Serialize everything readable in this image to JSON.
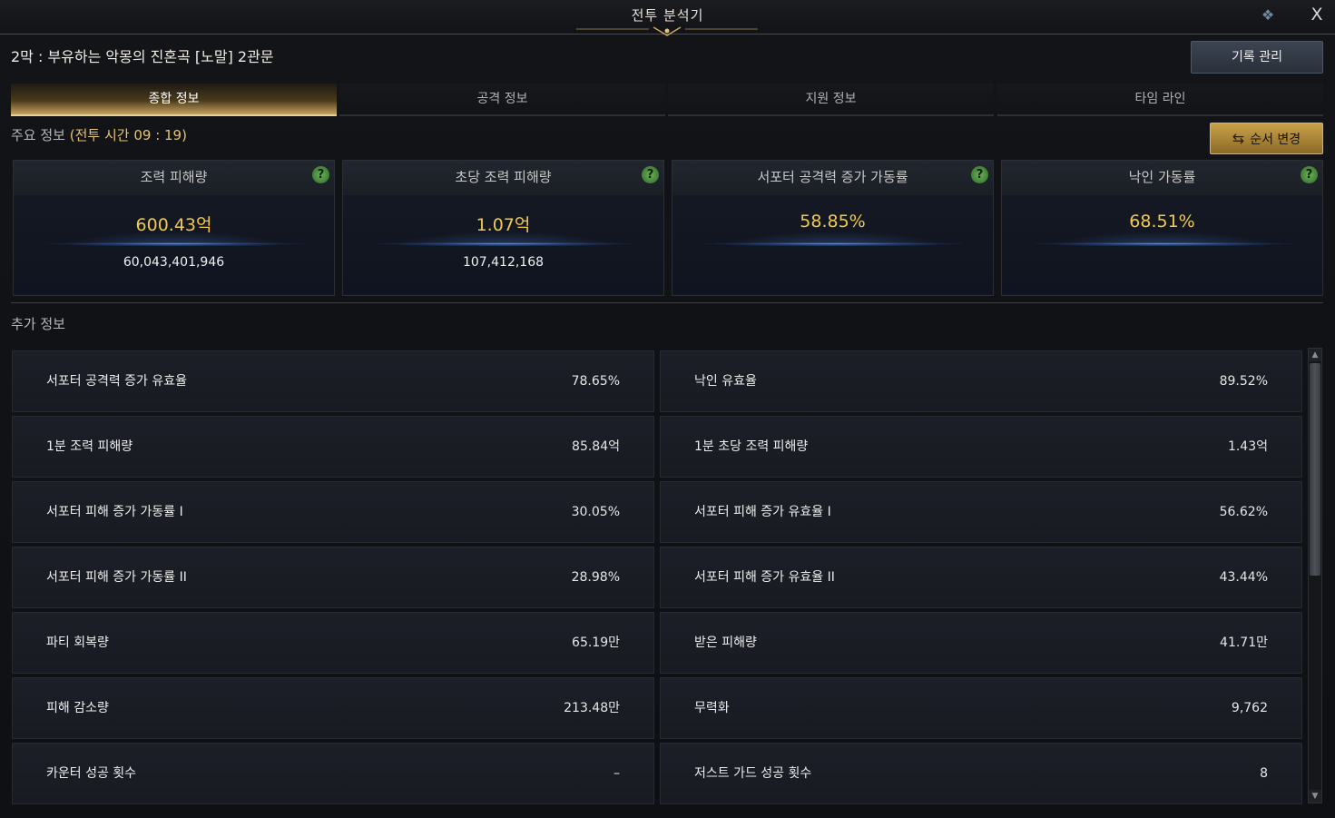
{
  "window": {
    "title": "전투 분석기",
    "close_label": "X",
    "corner_icon": "emblem-icon"
  },
  "header": {
    "dungeon_title": "2막 : 부유하는 악몽의 진혼곡 [노말] 2관문",
    "record_button": "기록 관리"
  },
  "tabs": [
    {
      "label": "종합 정보",
      "active": true
    },
    {
      "label": "공격 정보",
      "active": false
    },
    {
      "label": "지원 정보",
      "active": false
    },
    {
      "label": "타임 라인",
      "active": false
    }
  ],
  "main_info": {
    "label": "주요 정보",
    "battle_time": "(전투 시간 09 : 19)",
    "order_button": "순서 변경"
  },
  "cards": [
    {
      "title": "조력 피해량",
      "value": "600.43억",
      "sub": "60,043,401,946"
    },
    {
      "title": "초당 조력 피해량",
      "value": "1.07억",
      "sub": "107,412,168"
    },
    {
      "title": "서포터 공격력 증가 가동률",
      "value": "58.85%",
      "sub": ""
    },
    {
      "title": "낙인 가동률",
      "value": "68.51%",
      "sub": ""
    }
  ],
  "extra_info": {
    "label": "추가 정보",
    "rows": [
      {
        "left_name": "서포터 공격력 증가 유효율",
        "left_value": "78.65%",
        "right_name": "낙인 유효율",
        "right_value": "89.52%"
      },
      {
        "left_name": "1분 조력 피해량",
        "left_value": "85.84억",
        "right_name": "1분 초당 조력 피해량",
        "right_value": "1.43억"
      },
      {
        "left_name": "서포터 피해 증가 가동률 I",
        "left_value": "30.05%",
        "right_name": "서포터 피해 증가 유효율 I",
        "right_value": "56.62%"
      },
      {
        "left_name": "서포터 피해 증가 가동률 II",
        "left_value": "28.98%",
        "right_name": "서포터 피해 증가 유효율 II",
        "right_value": "43.44%"
      },
      {
        "left_name": "파티 회복량",
        "left_value": "65.19만",
        "right_name": "받은 피해량",
        "right_value": "41.71만"
      },
      {
        "left_name": "피해 감소량",
        "left_value": "213.48만",
        "right_name": "무력화",
        "right_value": "9,762"
      },
      {
        "left_name": "카운터 성공 횟수",
        "left_value": "–",
        "right_name": "저스트 가드 성공 횟수",
        "right_value": "8"
      }
    ]
  },
  "colors": {
    "gold_value": "#f2c94c",
    "active_tab": "#c7a460",
    "help_icon": "#6ab25a",
    "order_button": "#c9a14a"
  }
}
